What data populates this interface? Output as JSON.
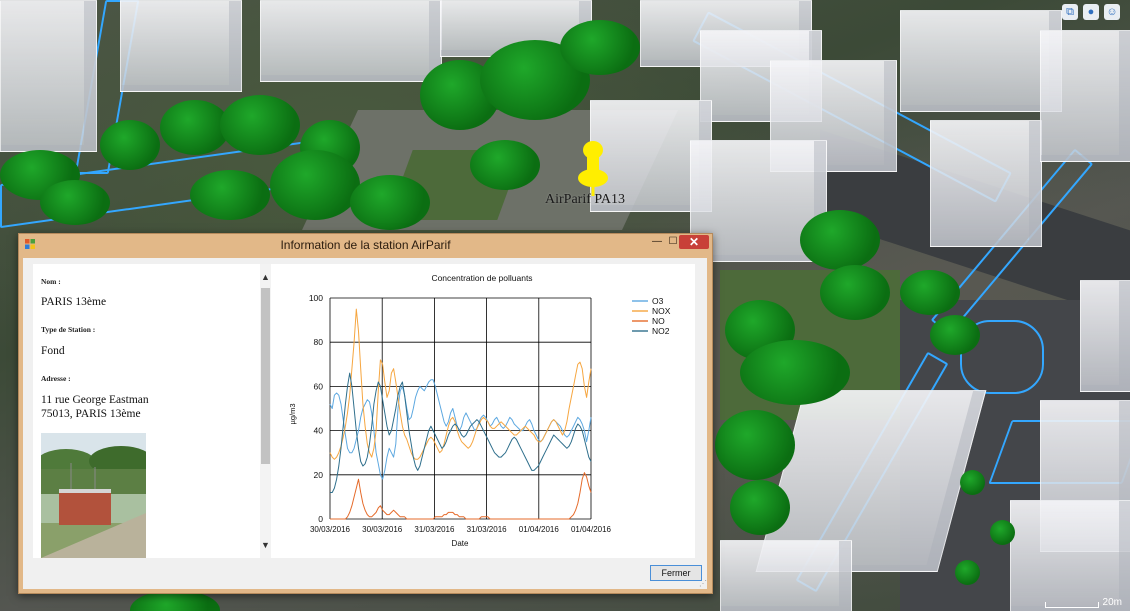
{
  "dialog": {
    "title": "Information de la station AirParif",
    "close_label": "Fermer"
  },
  "station": {
    "name_label": "Nom :",
    "name": "PARIS 13ème",
    "type_label": "Type de Station :",
    "type": "Fond",
    "address_label": "Adresse :",
    "address_line1": "11 rue George Eastman",
    "address_line2": "75013, PARIS 13ème"
  },
  "map": {
    "pin_label": "AirParif PA13",
    "scale_label": "20m"
  },
  "colors": {
    "O3": "#5da8e0",
    "NOX": "#f6a640",
    "NO": "#e56b2b",
    "NO2": "#2f6f8c",
    "pin": "#ffee00",
    "window_frame": "#e2b888"
  },
  "icons": [
    "app-icon",
    "minimize-icon",
    "maximize-icon",
    "close-icon",
    "scroll-up-icon",
    "scroll-down-icon",
    "map-tools-icon",
    "globe-icon",
    "pedestrian-icon"
  ],
  "chart_data": {
    "type": "line",
    "title": "Concentration de polluants",
    "xlabel": "Date",
    "ylabel": "µg/m3",
    "ylim": [
      0,
      100
    ],
    "yticks": [
      0,
      20,
      40,
      60,
      80,
      100
    ],
    "xtick_labels": [
      "30/03/2016",
      "30/03/2016",
      "31/03/2016",
      "31/03/2016",
      "01/04/2016",
      "01/04/2016"
    ],
    "grid": true,
    "legend": "top-right",
    "x": [
      0,
      1,
      2,
      3,
      4,
      5,
      6,
      7,
      8,
      9,
      10,
      11,
      12,
      13,
      14,
      15,
      16,
      17,
      18,
      19,
      20,
      21,
      22,
      23,
      24,
      25,
      26,
      27,
      28,
      29,
      30,
      31,
      32,
      33,
      34,
      35,
      36,
      37,
      38,
      39,
      40,
      41,
      42,
      43,
      44,
      45,
      46,
      47,
      48,
      49,
      50,
      51,
      52,
      53,
      54,
      55,
      56,
      57,
      58,
      59,
      60,
      61,
      62,
      63,
      64,
      65,
      66,
      67,
      68,
      69,
      70,
      71,
      72,
      73,
      74,
      75,
      76,
      77,
      78,
      79,
      80,
      81,
      82,
      83,
      84,
      85,
      86,
      87,
      88,
      89,
      90,
      91,
      92,
      93,
      94,
      95,
      96,
      97,
      98,
      99,
      100,
      101,
      102,
      103,
      104,
      105,
      106,
      107,
      108,
      109,
      110,
      111,
      112,
      113,
      114,
      115,
      116,
      117,
      118,
      119
    ],
    "series": [
      {
        "name": "O3",
        "values": [
          52,
          50,
          56,
          57,
          56,
          52,
          45,
          38,
          32,
          30,
          30,
          32,
          36,
          40,
          46,
          50,
          52,
          54,
          53,
          48,
          40,
          30,
          25,
          20,
          18,
          22,
          28,
          32,
          30,
          28,
          34,
          50,
          58,
          60,
          56,
          50,
          45,
          46,
          50,
          55,
          58,
          60,
          59,
          58,
          60,
          62,
          63,
          63,
          60,
          56,
          52,
          48,
          44,
          42,
          44,
          48,
          50,
          46,
          42,
          40,
          42,
          46,
          48,
          46,
          44,
          42,
          40,
          41,
          44,
          46,
          47,
          46,
          44,
          42,
          43,
          45,
          46,
          44,
          42,
          41,
          42,
          44,
          46,
          45,
          43,
          42,
          41,
          40,
          40,
          42,
          44,
          45,
          43,
          40,
          38,
          36,
          35,
          36,
          38,
          40,
          42,
          44,
          45,
          44,
          43,
          42,
          40,
          38,
          37,
          38,
          40,
          42,
          44,
          46,
          45,
          43,
          40,
          35,
          40,
          46
        ]
      },
      {
        "name": "NOX",
        "values": [
          30,
          28,
          27,
          28,
          30,
          33,
          37,
          42,
          48,
          56,
          68,
          80,
          95,
          85,
          68,
          52,
          42,
          34,
          30,
          28,
          32,
          40,
          58,
          72,
          70,
          62,
          55,
          58,
          66,
          68,
          62,
          55,
          48,
          42,
          38,
          36,
          33,
          30,
          28,
          27,
          27,
          28,
          30,
          32,
          34,
          36,
          37,
          36,
          34,
          32,
          30,
          31,
          34,
          38,
          42,
          45,
          46,
          44,
          40,
          37,
          35,
          34,
          33,
          32,
          33,
          35,
          38,
          41,
          43,
          45,
          46,
          45,
          44,
          42,
          41,
          41,
          42,
          43,
          44,
          43,
          42,
          41,
          40,
          39,
          38,
          38,
          39,
          40,
          41,
          42,
          41,
          40,
          39,
          38,
          36,
          35,
          35,
          36,
          38,
          40,
          42,
          44,
          45,
          44,
          42,
          40,
          38,
          40,
          44,
          50,
          55,
          60,
          65,
          70,
          71,
          68,
          60,
          55,
          62,
          68
        ]
      },
      {
        "name": "NO",
        "values": [
          0,
          0,
          0,
          0,
          0,
          0,
          0,
          0,
          1,
          3,
          6,
          10,
          14,
          18,
          12,
          7,
          4,
          2,
          1,
          1,
          2,
          3,
          5,
          6,
          4,
          3,
          2,
          2,
          3,
          4,
          3,
          2,
          1,
          1,
          1,
          0,
          0,
          0,
          0,
          0,
          0,
          0,
          0,
          0,
          0,
          0,
          0,
          0,
          1,
          1,
          1,
          1,
          2,
          2,
          3,
          3,
          3,
          2,
          2,
          1,
          1,
          1,
          0,
          0,
          0,
          0,
          0,
          0,
          0,
          1,
          1,
          1,
          1,
          0,
          0,
          0,
          0,
          0,
          0,
          0,
          0,
          0,
          0,
          0,
          0,
          0,
          0,
          0,
          0,
          0,
          0,
          0,
          0,
          0,
          0,
          0,
          0,
          0,
          0,
          0,
          0,
          0,
          0,
          0,
          0,
          0,
          0,
          0,
          0,
          0,
          1,
          2,
          4,
          7,
          12,
          18,
          21,
          19,
          15,
          12
        ]
      },
      {
        "name": "NO2",
        "values": [
          12,
          12,
          14,
          18,
          24,
          32,
          42,
          52,
          60,
          66,
          60,
          50,
          40,
          32,
          26,
          24,
          25,
          28,
          34,
          42,
          52,
          58,
          62,
          60,
          54,
          48,
          42,
          38,
          40,
          45,
          50,
          56,
          60,
          62,
          56,
          48,
          40,
          34,
          28,
          24,
          22,
          24,
          28,
          32,
          36,
          40,
          42,
          40,
          38,
          36,
          34,
          32,
          33,
          35,
          38,
          40,
          42,
          43,
          42,
          40,
          38,
          37,
          38,
          40,
          42,
          43,
          44,
          45,
          44,
          42,
          40,
          38,
          36,
          34,
          32,
          30,
          29,
          28,
          28,
          29,
          30,
          32,
          34,
          36,
          37,
          36,
          34,
          32,
          30,
          28,
          26,
          24,
          22,
          22,
          23,
          24,
          26,
          28,
          30,
          32,
          34,
          36,
          38,
          37,
          36,
          35,
          34,
          33,
          32,
          33,
          35,
          38,
          41,
          43,
          42,
          40,
          36,
          32,
          28,
          26
        ]
      }
    ]
  }
}
